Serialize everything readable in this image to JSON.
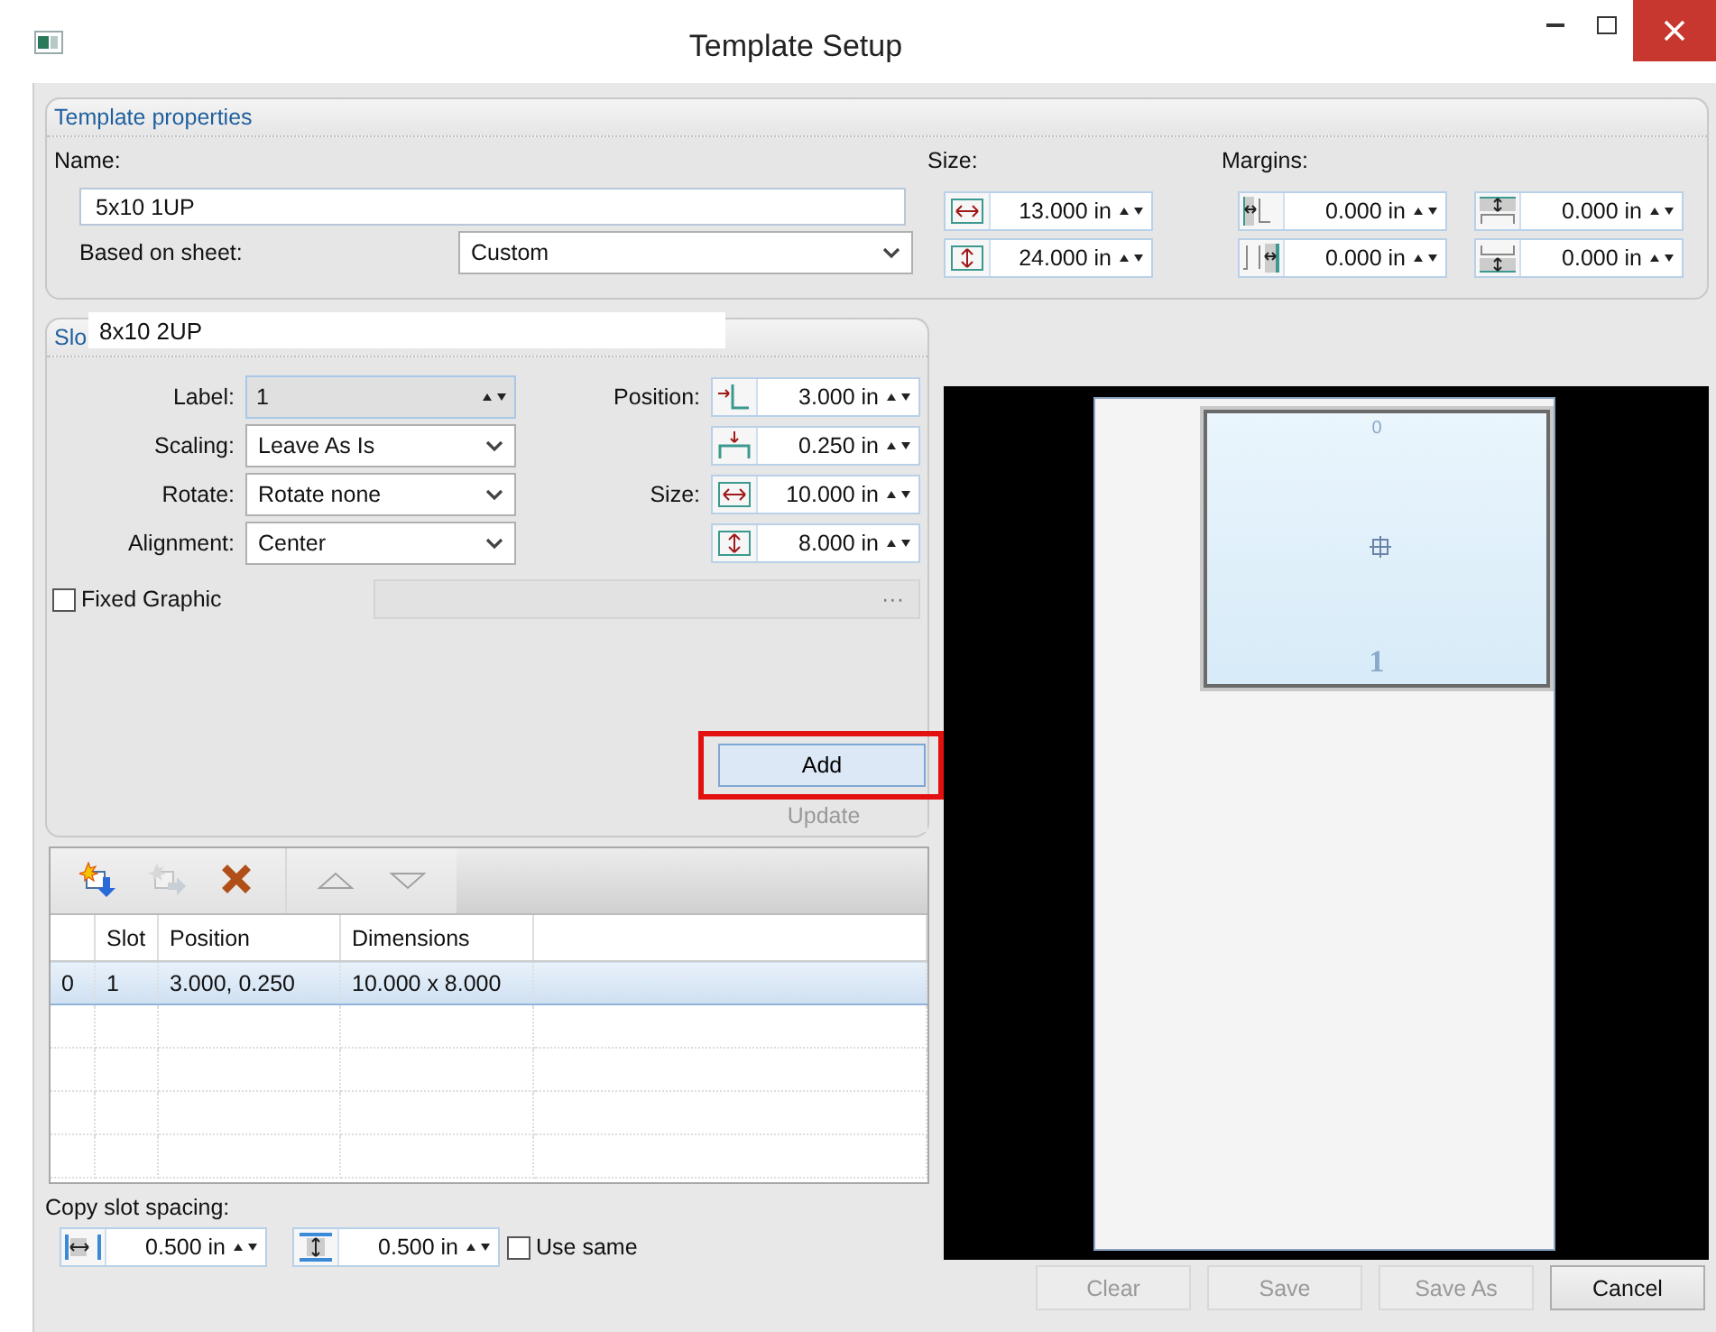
{
  "window": {
    "title": "Template Setup"
  },
  "template_properties": {
    "title": "Template properties",
    "name_label": "Name:",
    "name_value": "5x10 1UP",
    "sheet_label": "Based on sheet:",
    "sheet_value": "Custom",
    "size_label": "Size:",
    "size_fields": [
      {
        "kind": "width",
        "value": "13.000 in"
      },
      {
        "kind": "height",
        "value": "24.000 in"
      }
    ],
    "margins_label": "Margins:",
    "margin_fields": [
      {
        "kind": "left",
        "value": "0.000 in"
      },
      {
        "kind": "top",
        "value": "0.000 in"
      },
      {
        "kind": "right",
        "value": "0.000 in"
      },
      {
        "kind": "bottom",
        "value": "0.000 in"
      }
    ]
  },
  "slot_group": {
    "title": "Slo",
    "overlay_value": "8x10 2UP",
    "left_rows": [
      {
        "label": "Label:",
        "kind": "spin",
        "value": "1"
      },
      {
        "label": "Scaling:",
        "kind": "dropdown",
        "value": "Leave As Is"
      },
      {
        "label": "Rotate:",
        "kind": "dropdown",
        "value": "Rotate none"
      },
      {
        "label": "Alignment:",
        "kind": "dropdown",
        "value": "Center"
      }
    ],
    "right_rows": [
      {
        "label": "Position:",
        "kind": "x",
        "value": "3.000 in"
      },
      {
        "kind": "y",
        "value": "0.250 in"
      },
      {
        "label": "Size:",
        "kind": "width",
        "value": "10.000 in"
      },
      {
        "kind": "height",
        "value": "8.000 in"
      }
    ],
    "fixed_graphic": {
      "label": "Fixed Graphic",
      "checked": false
    },
    "browse": "···",
    "add_button": {
      "label": "Add",
      "highlighted": true
    },
    "update_button": {
      "label": "Update",
      "disabled": true
    }
  },
  "slot_list": {
    "toolbar": [
      {
        "kind": "add",
        "disabled": false
      },
      {
        "kind": "duplicate",
        "disabled": true
      },
      {
        "kind": "delete",
        "disabled": false
      },
      {
        "kind": "up",
        "disabled": true
      },
      {
        "kind": "down",
        "disabled": true
      }
    ],
    "columns": [
      "Slot",
      "Position",
      "Dimensions"
    ],
    "rows": [
      {
        "index": "0",
        "slot": "1",
        "position": "3.000, 0.250",
        "dimensions": "10.000 x 8.000",
        "selected": true
      }
    ]
  },
  "copy_spacing": {
    "label": "Copy slot spacing:",
    "fields": [
      {
        "kind": "horizontal",
        "value": "0.500 in"
      },
      {
        "kind": "vertical",
        "value": "0.500 in"
      }
    ],
    "use_same": {
      "label": "Use same",
      "checked": false
    }
  },
  "preview": {
    "slots": [
      {
        "index": "0",
        "label": "1"
      }
    ]
  },
  "buttons": [
    {
      "label": "Clear",
      "disabled": true
    },
    {
      "label": "Save",
      "disabled": true
    },
    {
      "label": "Save As",
      "disabled": true
    },
    {
      "label": "Cancel",
      "disabled": false
    }
  ]
}
